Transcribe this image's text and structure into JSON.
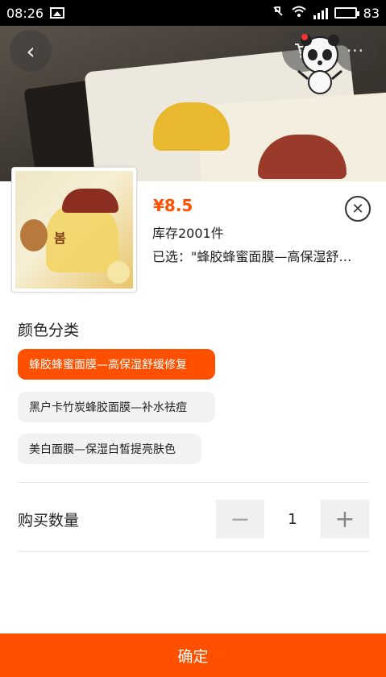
{
  "status_bar": {
    "time": "08:26",
    "battery": "83"
  },
  "product": {
    "price": "¥8.5",
    "stock": "库存2001件",
    "selected": "已选：\"蜂胶蜂蜜面膜—高保湿舒…",
    "thumb_brand": "봄"
  },
  "header": {
    "back_icon": "‹",
    "cart_icon": "cart-icon",
    "more_icon": "···"
  },
  "options": {
    "title": "颜色分类",
    "items": [
      {
        "label": "蜂胶蜂蜜面膜—高保湿舒缓修复",
        "selected": true
      },
      {
        "label": "黑户卡竹炭蜂胶面膜—补水祛痘",
        "selected": false
      },
      {
        "label": "美白面膜—保湿白皙提亮肤色",
        "selected": false
      }
    ]
  },
  "quantity": {
    "label": "购买数量",
    "value": "1",
    "minus": "−",
    "plus": "+"
  },
  "confirm_label": "确定",
  "colors": {
    "accent": "#ff5000"
  }
}
